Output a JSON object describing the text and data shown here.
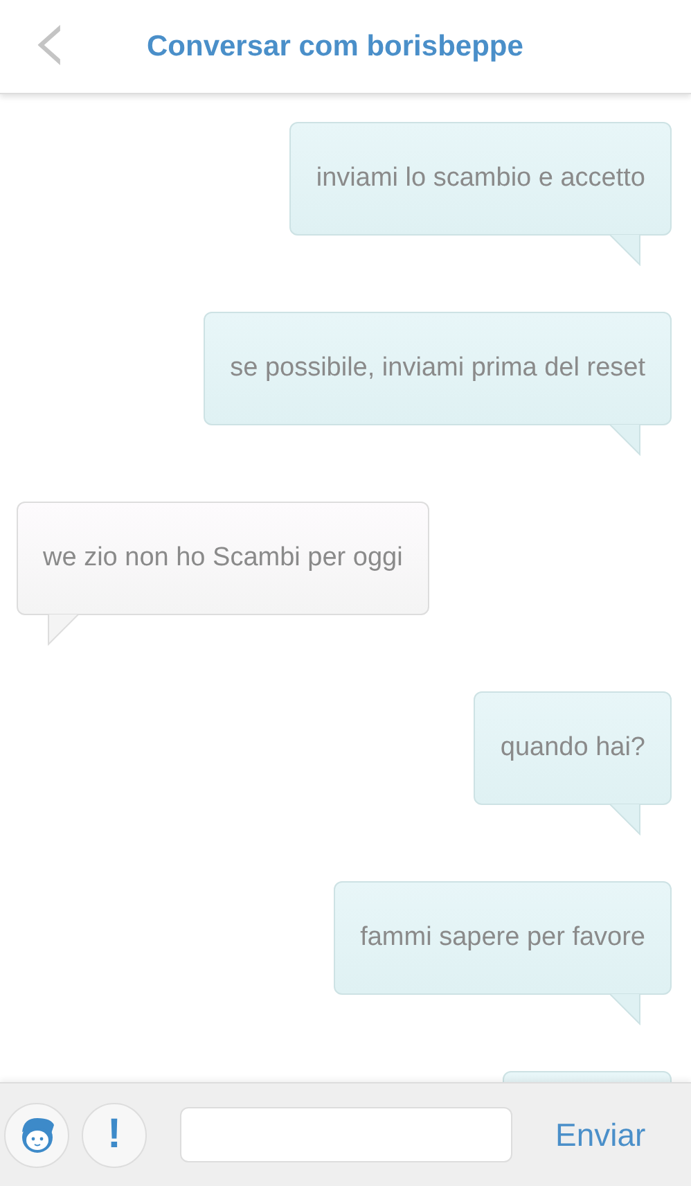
{
  "header": {
    "back": "‹",
    "title": "Conversar com borisbeppe"
  },
  "messages": [
    {
      "kind": "sent",
      "text": "inviami lo scambio e accetto"
    },
    {
      "kind": "sent",
      "text": "se possibile, inviami prima del reset"
    },
    {
      "kind": "received",
      "text": "we zio non ho Scambi per oggi"
    },
    {
      "kind": "sent",
      "text": "quando hai?"
    },
    {
      "kind": "sent",
      "text": "fammi sapere per favore"
    },
    {
      "kind": "sent",
      "cut_off": true
    }
  ],
  "composer": {
    "alert": "!",
    "send": "Enviar"
  }
}
